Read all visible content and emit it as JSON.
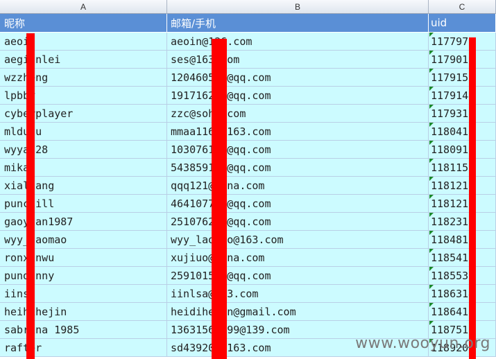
{
  "columns": [
    "A",
    "B",
    "C"
  ],
  "header": {
    "nickname": "昵称",
    "email": "邮箱/手机",
    "uid": "uid"
  },
  "rows": [
    {
      "nick": "aeoin",
      "email": "aeoin@126.com",
      "uid": "1177978"
    },
    {
      "nick": "aegianlei",
      "email": "ses@163.com",
      "uid": "1179015"
    },
    {
      "nick": "wzzheng",
      "email": "120460514@qq.com",
      "uid": "1179155"
    },
    {
      "nick": "lpbby",
      "email": "191716244@qq.com",
      "uid": "1179144"
    },
    {
      "nick": "cyberplayer",
      "email": "zzc@sohu.com",
      "uid": "1179311"
    },
    {
      "nick": "mldudu",
      "email": "mmaa1163@163.com",
      "uid": "1180413"
    },
    {
      "nick": "wyyan28",
      "email": "103076128@qq.com",
      "uid": "1180911"
    },
    {
      "nick": "mikan",
      "email": "543859120@qq.com",
      "uid": "1181155"
    },
    {
      "nick": "xialiang",
      "email": "qqq121@sina.com",
      "uid": "1181212"
    },
    {
      "nick": "punchill",
      "email": "464107721@qq.com",
      "uid": "1181219"
    },
    {
      "nick": "gaoyuan1987",
      "email": "251076234@qq.com",
      "uid": "1182312"
    },
    {
      "nick": "wyy_laomao",
      "email": "wyy_laomao@163.com",
      "uid": "1184819"
    },
    {
      "nick": "ronxinwu",
      "email": "xujiuo@sina.com",
      "uid": "1185411"
    },
    {
      "nick": "pundanny",
      "email": "259101595@qq.com",
      "uid": "1185538"
    },
    {
      "nick": "iinsa",
      "email": "iinlsa@163.com",
      "uid": "1186314"
    },
    {
      "nick": "heihihejin",
      "email": "heidihejin@gmail.com",
      "uid": "1186411"
    },
    {
      "nick": "sabrina  1985",
      "email": "13631569699@139.com",
      "uid": "1187512"
    },
    {
      "nick": "rafter",
      "email": "sd439203@163.com",
      "uid": "1189208"
    }
  ],
  "watermark": "www.wooyun.org",
  "colors": {
    "header_bg": "#5a8fd6",
    "row_bg": "#ccfbff",
    "redaction": "#ff0000"
  }
}
